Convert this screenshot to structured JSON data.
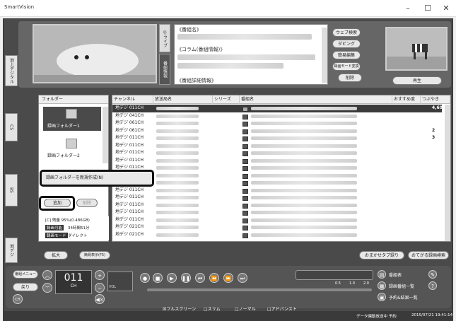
{
  "window": {
    "title": "SmartVision",
    "minimize": "–",
    "maximize": "☐",
    "close": "✕"
  },
  "vertical_tabs": {
    "live": "◎ライブ",
    "info": "番組情報"
  },
  "side_tabs": [
    "地上デジタル",
    "CS",
    "BS",
    "地デジ"
  ],
  "program_info": {
    "title_label": "《番組名》",
    "column_label": "《コラム(番組情報)》",
    "detail_label": "《番組詳細情報》"
  },
  "top_buttons": [
    "ウェブ検索",
    "ダビング",
    "簡易編集",
    "録画モード変換",
    "削除"
  ],
  "play_button": "再生",
  "folders": {
    "header": "フォルダー",
    "items": [
      "録画フォルダー1",
      "録画フォルダー2"
    ]
  },
  "context_menu": {
    "item": "録画フォルダーを新規作成(N)"
  },
  "folder_actions": {
    "add": "追加",
    "delete": "削除"
  },
  "storage": {
    "free": "[C] 残量 95%(0.486GB)",
    "rec_label": "録画可能",
    "rec_time": "34時間51分",
    "mode_label": "録画モード",
    "mode_value": "ダイレクト"
  },
  "list": {
    "columns": [
      "チャンネル",
      "放送局名",
      "シリーズ",
      "番組名",
      "おすすめ度",
      "つぶやき"
    ],
    "rows": [
      {
        "ch": "地デジ 011CH",
        "score": "4,60"
      },
      {
        "ch": "地デジ 041CH",
        "score": ""
      },
      {
        "ch": "地デジ 061CH",
        "score": ""
      },
      {
        "ch": "地デジ 061CH",
        "score": "2"
      },
      {
        "ch": "地デジ 011CH",
        "score": "3"
      },
      {
        "ch": "地デジ 011CH",
        "score": ""
      },
      {
        "ch": "地デジ 011CH",
        "score": ""
      },
      {
        "ch": "地デジ 011CH",
        "score": ""
      },
      {
        "ch": "地デジ 011CH",
        "score": ""
      },
      {
        "ch": "地デジ 011CH",
        "score": ""
      },
      {
        "ch": "地デジ 011CH",
        "score": ""
      },
      {
        "ch": "地デジ 011CH",
        "score": ""
      },
      {
        "ch": "地デジ 011CH",
        "score": ""
      },
      {
        "ch": "地デジ 011CH",
        "score": ""
      },
      {
        "ch": "地デジ 011CH",
        "score": ""
      },
      {
        "ch": "地デジ 011CH",
        "score": ""
      },
      {
        "ch": "地デジ 021CH",
        "score": ""
      },
      {
        "ch": "地デジ 021CH",
        "score": ""
      }
    ]
  },
  "bottom_left": {
    "zoom": "拡大",
    "sub": "簡易表示(F5)"
  },
  "bottom_right": {
    "omakase": "おまかせタブ録り",
    "oshiete": "おてがる録画検索"
  },
  "controls": {
    "remote": "番組メニュー",
    "back": "戻り",
    "channel": "011",
    "ch_label": "CH",
    "ch_btn": "CH",
    "vol_label": "VOL",
    "guide": "番組表",
    "rec_list": "録画番組一覧",
    "reserve": "予約&結果一覧",
    "speed_marks": [
      "0.5",
      "1.0",
      "2.0"
    ]
  },
  "view_modes": [
    "☒フルスクリーン",
    "□スリム",
    "□ノーマル",
    "□アドバンスト"
  ],
  "status": {
    "text": "データ連動放送中 予約",
    "datetime": "2015/07/21 19:41:14"
  }
}
